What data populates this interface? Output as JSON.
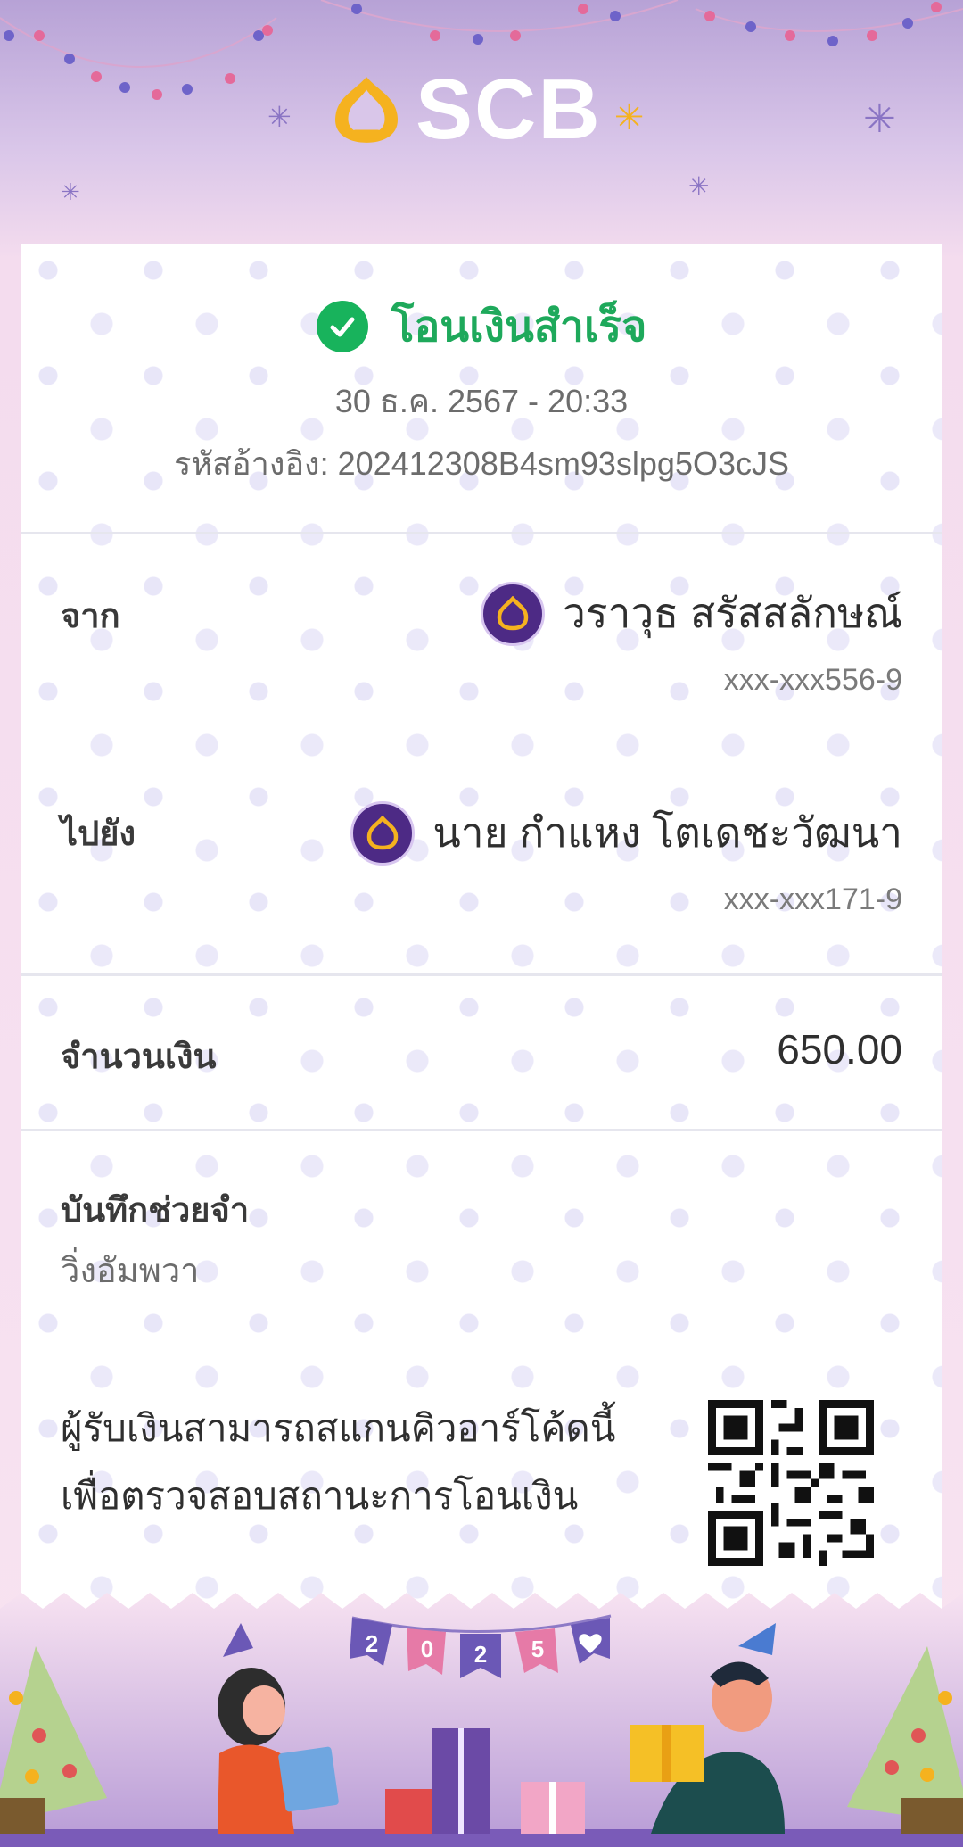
{
  "header": {
    "brand": "SCB",
    "logo_icon": "scb-bell-logo-icon"
  },
  "receipt": {
    "status": "โอนเงินสำเร็จ",
    "status_icon": "check-circle-icon",
    "datetime": "30 ธ.ค. 2567 - 20:33",
    "reference": "รหัสอ้างอิง: 202412308B4sm93slpg5O3cJS",
    "from": {
      "label": "จาก",
      "name": "วราวุธ สรัสสลักษณ์",
      "account": "xxx-xxx556-9",
      "bank_icon": "scb-bank-icon"
    },
    "to": {
      "label": "ไปยัง",
      "name": "นาย กำแหง โตเดชะวัฒนา",
      "account": "xxx-xxx171-9",
      "bank_icon": "scb-bank-icon"
    },
    "amount": {
      "label": "จำนวนเงิน",
      "value": "650.00"
    },
    "memo": {
      "label": "บันทึกช่วยจำ",
      "value": "วิ่งอัมพวา"
    },
    "qr": {
      "text": "ผู้รับเงินสามารถสแกนคิวอาร์โค้ดนี้เพื่อตรวจสอบสถานะการโอนเงิน",
      "icon": "qr-code-icon"
    }
  },
  "footer": {
    "flags": [
      "2",
      "0",
      "2",
      "5"
    ],
    "heart_icon": "heart-icon"
  },
  "colors": {
    "success": "#1ea95b",
    "brand_purple": "#4d2a85",
    "brand_gold": "#f5b21f"
  }
}
